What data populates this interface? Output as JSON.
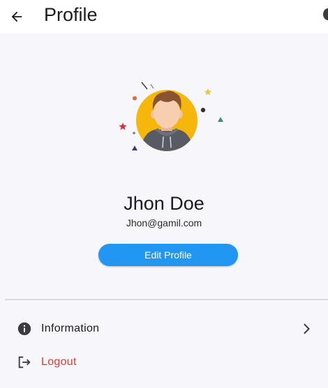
{
  "header": {
    "title": "Profile",
    "back_icon": "arrow-back-icon"
  },
  "profile": {
    "name": "Jhon Doe",
    "email": "Jhon@gamil.com",
    "edit_label": "Edit Profile",
    "avatar_icon": "user-avatar-illustration"
  },
  "menu": {
    "items": [
      {
        "label": "Information",
        "icon": "info-icon",
        "trailing_icon": "chevron-right-icon"
      },
      {
        "label": "Logout",
        "icon": "logout-icon"
      }
    ]
  },
  "colors": {
    "accent": "#2196f3",
    "danger": "#e53935",
    "background": "#f6f6fb",
    "appbar": "#ffffff"
  }
}
